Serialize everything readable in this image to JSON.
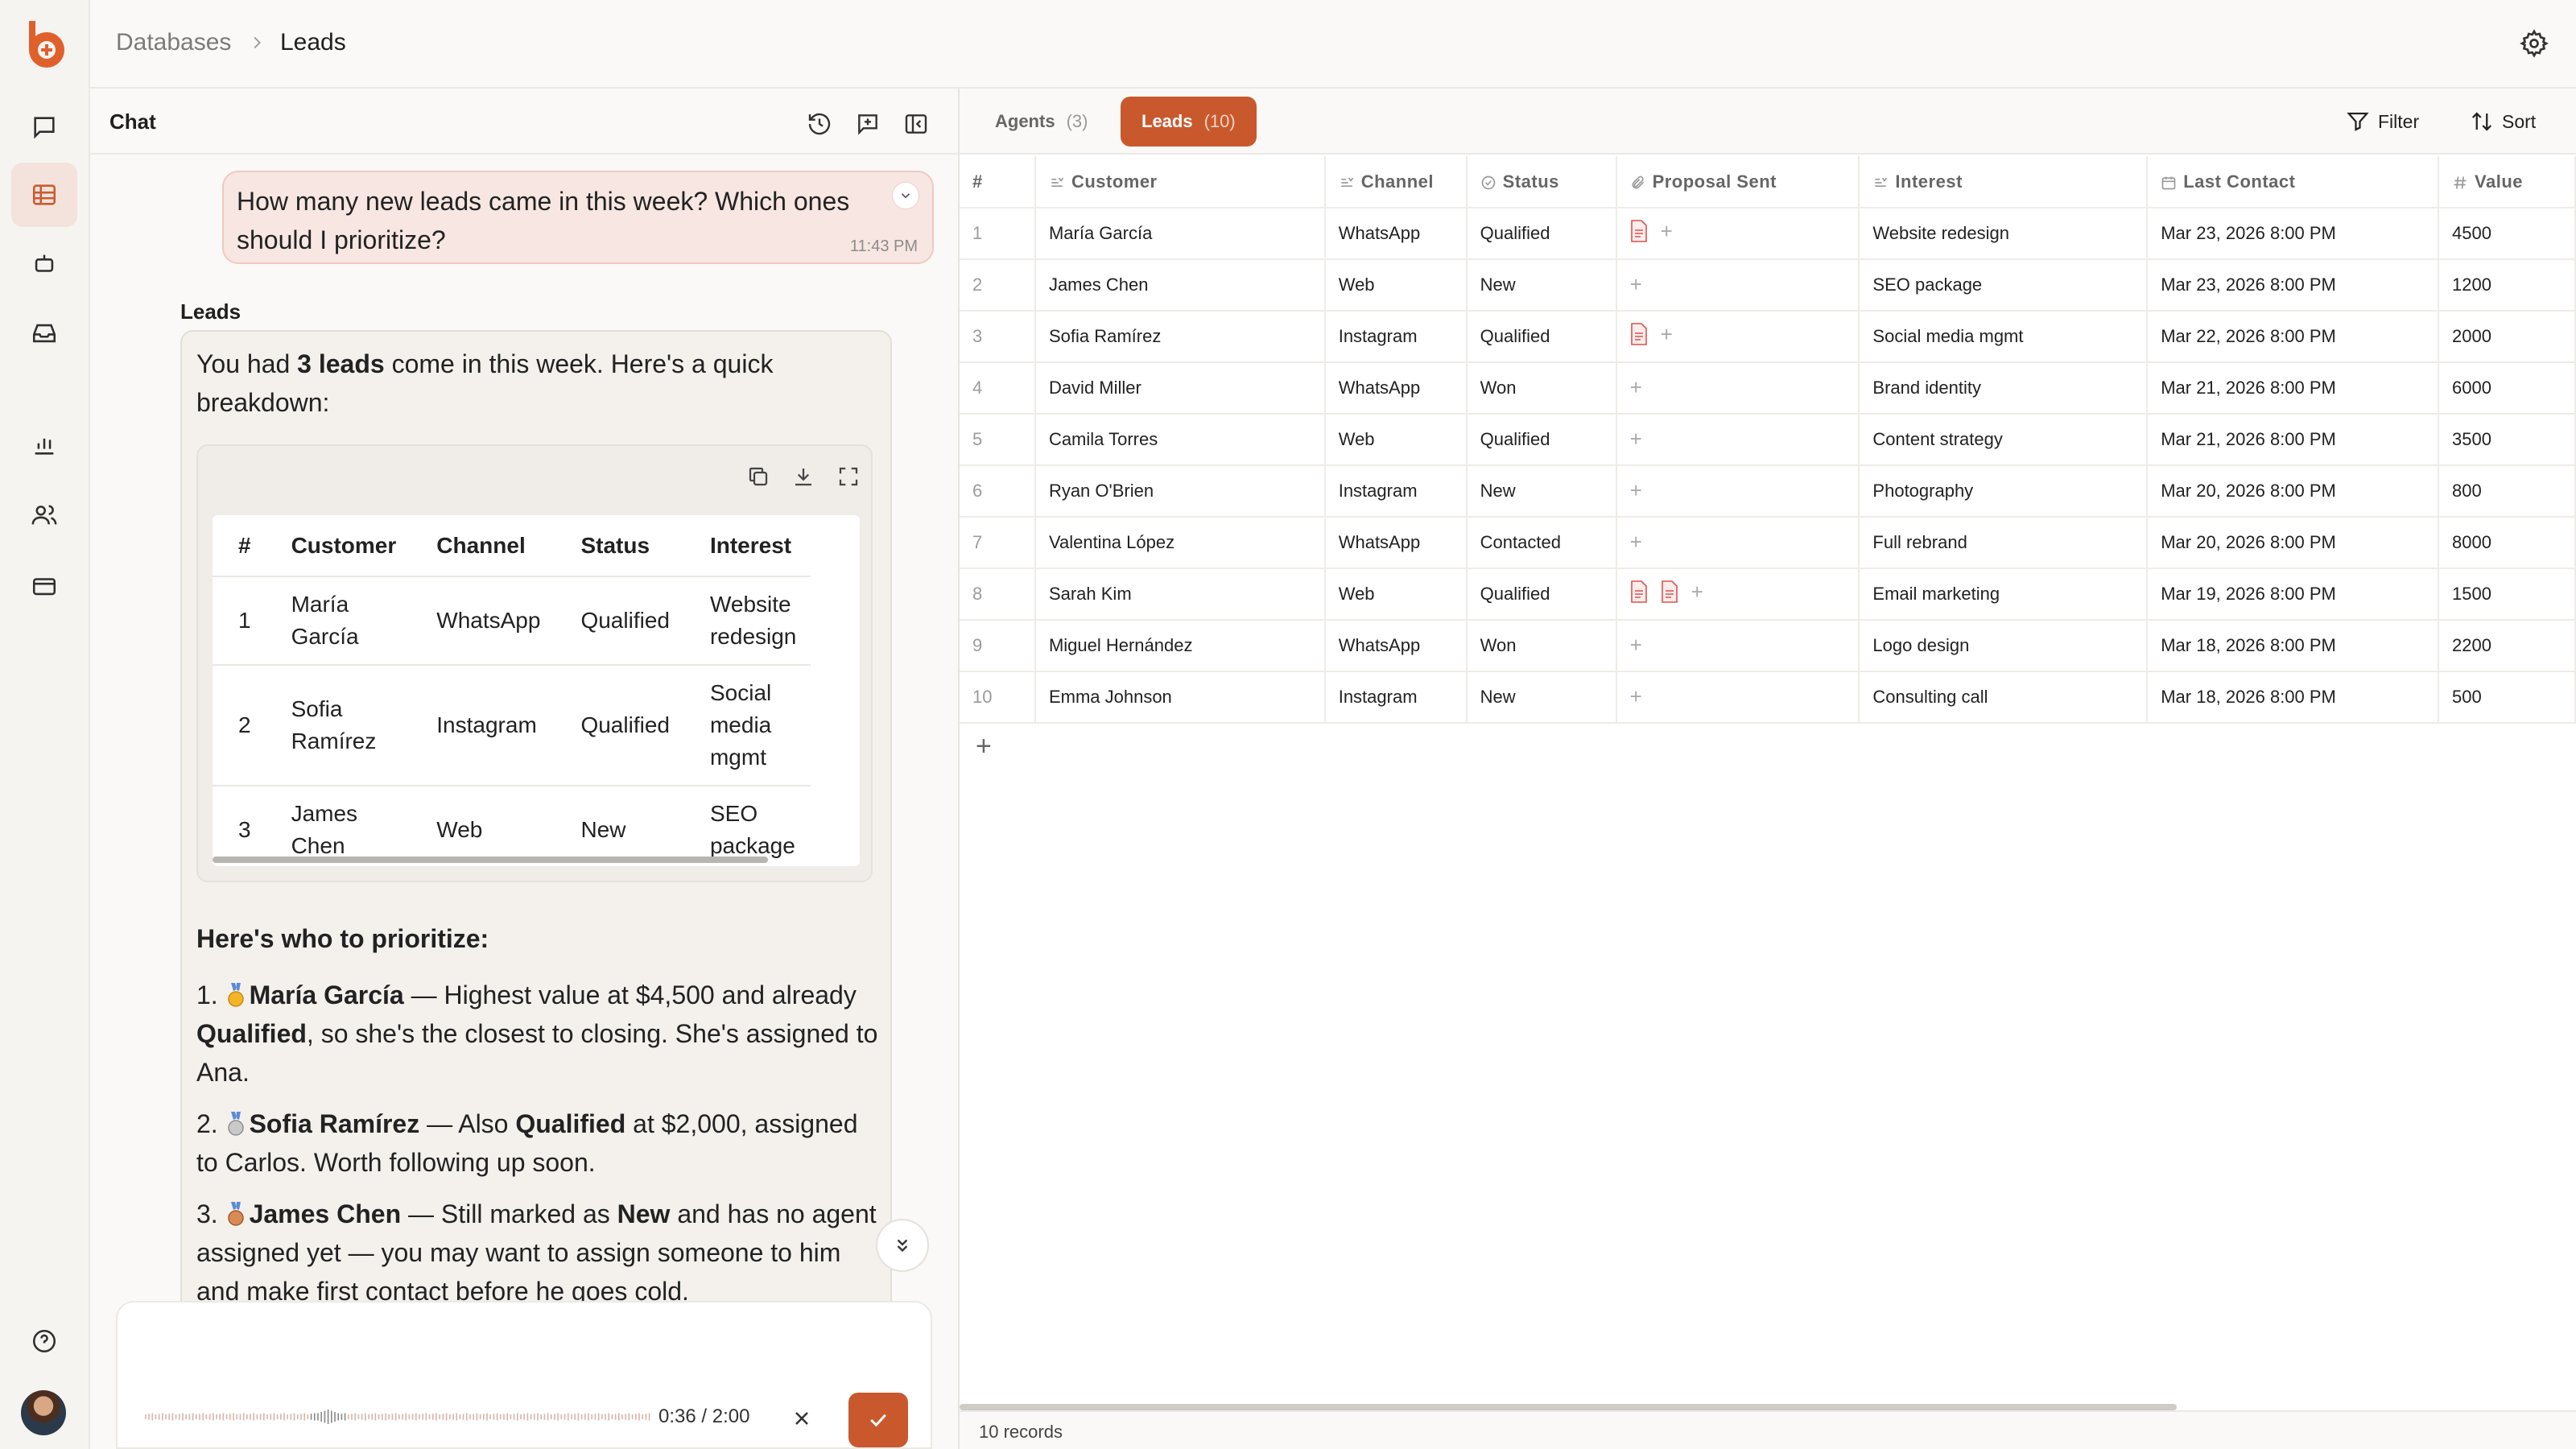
{
  "breadcrumb": {
    "root": "Databases",
    "current": "Leads"
  },
  "chat": {
    "title": "Chat",
    "user_message": "How many new leads came in this week? Which ones should I prioritize?",
    "user_time": "11:43 PM",
    "agent_name": "Leads",
    "intro_pre": "You had ",
    "intro_bold": "3 leads",
    "intro_post": " come in this week. Here's a quick breakdown:",
    "table": {
      "headers": [
        "#",
        "Customer",
        "Channel",
        "Status",
        "Interest"
      ],
      "rows": [
        [
          "1",
          "María García",
          "WhatsApp",
          "Qualified",
          "Website redesign"
        ],
        [
          "2",
          "Sofia Ramírez",
          "Instagram",
          "Qualified",
          "Social media mgmt"
        ],
        [
          "3",
          "James Chen",
          "Web",
          "New",
          "SEO package"
        ]
      ]
    },
    "prioritize_title": "Here's who to prioritize:",
    "priorities": [
      {
        "n": "1.",
        "name": "María García",
        "a": " — Highest value at $4,500 and already ",
        "b": "Qualified",
        "c": ", so she's the closest to closing. She's assigned to Ana."
      },
      {
        "n": "2.",
        "name": "Sofia Ramírez",
        "a": " — Also ",
        "b": "Qualified",
        "c": " at $2,000, assigned to Carlos. Worth following up soon."
      },
      {
        "n": "3.",
        "name": "James Chen",
        "a": " — Still marked as ",
        "b": "New",
        "c": " and has no agent assigned yet — you may want to assign someone to him and make first contact before he goes cold."
      }
    ],
    "recording": {
      "elapsed": "0:36",
      "total": "2:00",
      "progress": 0.3
    }
  },
  "data_tabs": [
    {
      "label": "Agents",
      "count": "(3)"
    },
    {
      "label": "Leads",
      "count": "(10)"
    }
  ],
  "toolbar": {
    "filter": "Filter",
    "sort": "Sort"
  },
  "grid": {
    "headers": [
      "#",
      "Customer",
      "Channel",
      "Status",
      "Proposal Sent",
      "Interest",
      "Last Contact",
      "Value"
    ],
    "rows": [
      {
        "n": "1",
        "customer": "María García",
        "channel": "WhatsApp",
        "status": "Qualified",
        "proposals": 1,
        "interest": "Website redesign",
        "last": "Mar 23, 2026 8:00 PM",
        "value": "4500"
      },
      {
        "n": "2",
        "customer": "James Chen",
        "channel": "Web",
        "status": "New",
        "proposals": 0,
        "interest": "SEO package",
        "last": "Mar 23, 2026 8:00 PM",
        "value": "1200"
      },
      {
        "n": "3",
        "customer": "Sofia Ramírez",
        "channel": "Instagram",
        "status": "Qualified",
        "proposals": 1,
        "interest": "Social media mgmt",
        "last": "Mar 22, 2026 8:00 PM",
        "value": "2000"
      },
      {
        "n": "4",
        "customer": "David Miller",
        "channel": "WhatsApp",
        "status": "Won",
        "proposals": 0,
        "interest": "Brand identity",
        "last": "Mar 21, 2026 8:00 PM",
        "value": "6000"
      },
      {
        "n": "5",
        "customer": "Camila Torres",
        "channel": "Web",
        "status": "Qualified",
        "proposals": 0,
        "interest": "Content strategy",
        "last": "Mar 21, 2026 8:00 PM",
        "value": "3500"
      },
      {
        "n": "6",
        "customer": "Ryan O'Brien",
        "channel": "Instagram",
        "status": "New",
        "proposals": 0,
        "interest": "Photography",
        "last": "Mar 20, 2026 8:00 PM",
        "value": "800"
      },
      {
        "n": "7",
        "customer": "Valentina López",
        "channel": "WhatsApp",
        "status": "Contacted",
        "proposals": 0,
        "interest": "Full rebrand",
        "last": "Mar 20, 2026 8:00 PM",
        "value": "8000"
      },
      {
        "n": "8",
        "customer": "Sarah Kim",
        "channel": "Web",
        "status": "Qualified",
        "proposals": 2,
        "interest": "Email marketing",
        "last": "Mar 19, 2026 8:00 PM",
        "value": "1500"
      },
      {
        "n": "9",
        "customer": "Miguel Hernández",
        "channel": "WhatsApp",
        "status": "Won",
        "proposals": 0,
        "interest": "Logo design",
        "last": "Mar 18, 2026 8:00 PM",
        "value": "2200"
      },
      {
        "n": "10",
        "customer": "Emma Johnson",
        "channel": "Instagram",
        "status": "New",
        "proposals": 0,
        "interest": "Consulting call",
        "last": "Mar 18, 2026 8:00 PM",
        "value": "500"
      }
    ]
  },
  "footer": {
    "records": "10 records"
  },
  "colors": {
    "accent": "#c9592d",
    "user_bubble": "#f7e6e1",
    "active_nav": "#f3e3dc"
  },
  "icons": {
    "rail": [
      "chat-icon",
      "table-icon",
      "bot-icon",
      "inbox-icon",
      "chart-icon",
      "users-icon",
      "card-icon",
      "help-icon"
    ],
    "chat_tools": [
      "history-icon",
      "new-chat-icon",
      "collapse-panel-icon"
    ],
    "embed_tools": [
      "copy-icon",
      "download-icon",
      "expand-icon"
    ],
    "medals": [
      "gold-medal-icon",
      "silver-medal-icon",
      "bronze-medal-icon"
    ]
  }
}
